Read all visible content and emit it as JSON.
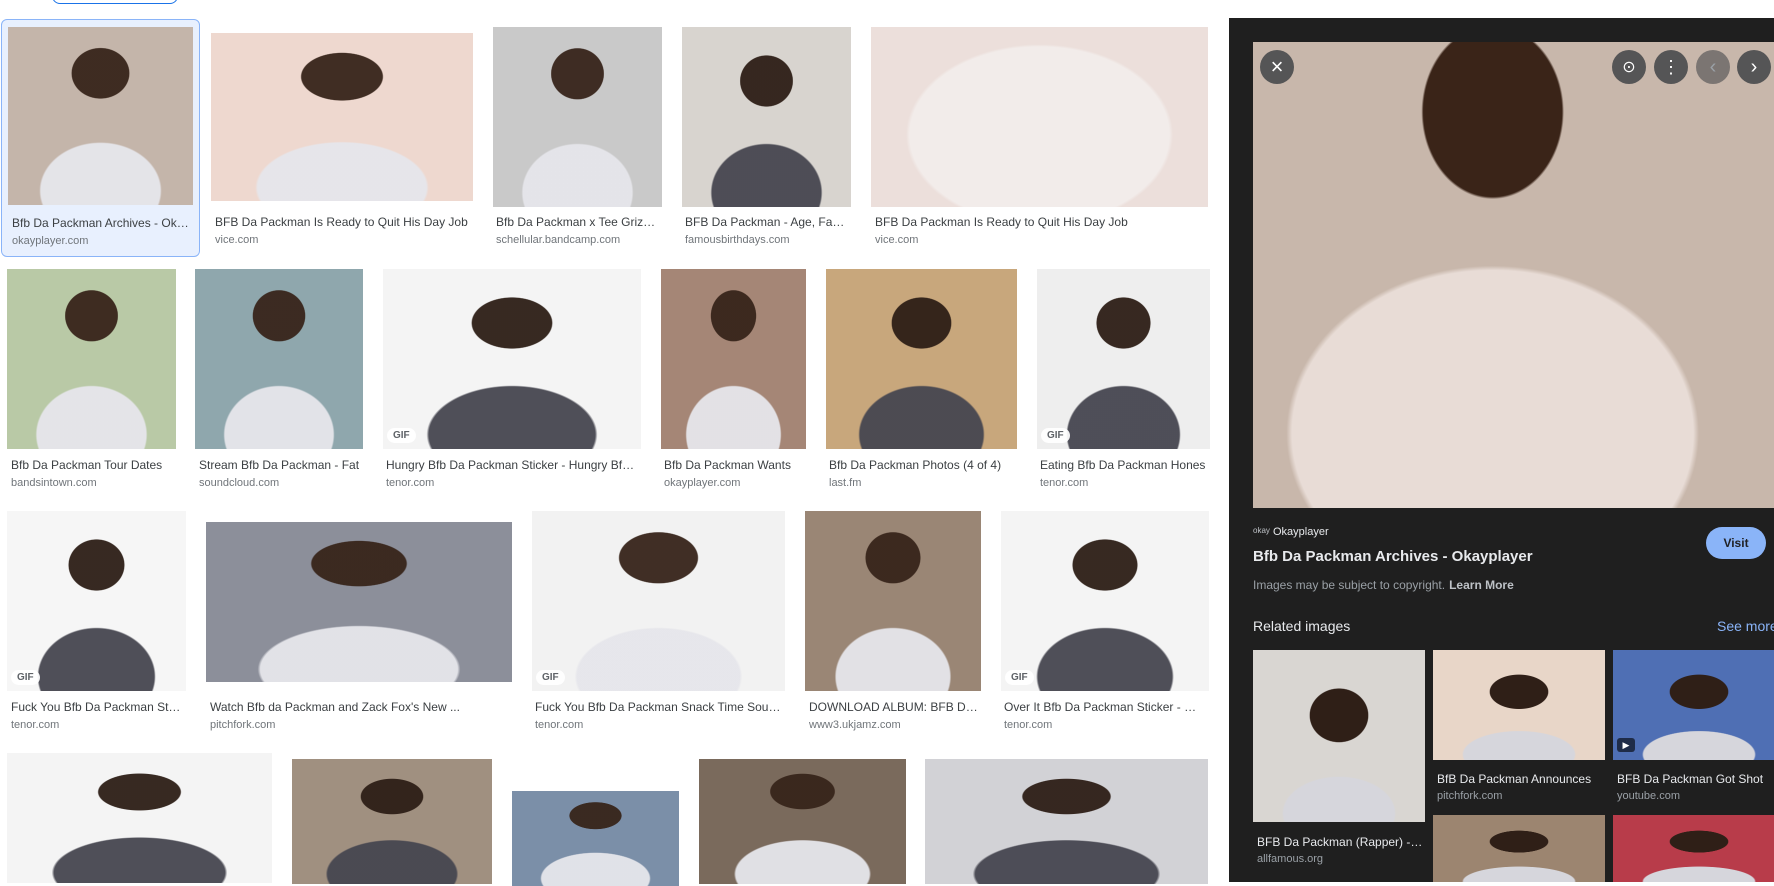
{
  "results": [
    {
      "title": "Bfb Da Packman Archives - Okayplayer",
      "source": "okayplayer.com",
      "gif": false
    },
    {
      "title": "BFB Da Packman Is Ready to Quit His Day Job",
      "source": "vice.com",
      "gif": false
    },
    {
      "title": "Bfb Da Packman x Tee Grizzley",
      "source": "schellular.bandcamp.com",
      "gif": false
    },
    {
      "title": "BFB Da Packman - Age, Family",
      "source": "famousbirthdays.com",
      "gif": false
    },
    {
      "title": "BFB Da Packman Is Ready to Quit His Day Job",
      "source": "vice.com",
      "gif": false
    },
    {
      "title": "Bfb Da Packman Tour Dates",
      "source": "bandsintown.com",
      "gif": false
    },
    {
      "title": "Stream Bfb Da Packman - Fat",
      "source": "soundcloud.com",
      "gif": false
    },
    {
      "title": "Hungry Bfb Da Packman Sticker - Hungry Bfb Da Packman",
      "source": "tenor.com",
      "gif": true
    },
    {
      "title": "Bfb Da Packman Wants",
      "source": "okayplayer.com",
      "gif": false
    },
    {
      "title": "Bfb Da Packman Photos (4 of 4)",
      "source": "last.fm",
      "gif": false
    },
    {
      "title": "Eating Bfb Da Packman Hones",
      "source": "tenor.com",
      "gif": true
    },
    {
      "title": "Fuck You Bfb Da Packman Sticker",
      "source": "tenor.com",
      "gif": true
    },
    {
      "title": "Watch Bfb da Packman and Zack Fox's New ...",
      "source": "pitchfork.com",
      "gif": false
    },
    {
      "title": "Fuck You Bfb Da Packman Snack Time Sounds",
      "source": "tenor.com",
      "gif": true
    },
    {
      "title": "DOWNLOAD ALBUM: BFB Da Packman",
      "source": "www3.ukjamz.com",
      "gif": false
    },
    {
      "title": "Over It Bfb Da Packman Sticker - Over It",
      "source": "tenor.com",
      "gif": true
    },
    {
      "title": "",
      "source": "",
      "gif": false
    },
    {
      "title": "",
      "source": "",
      "gif": false
    },
    {
      "title": "",
      "source": "",
      "gif": false
    },
    {
      "title": "",
      "source": "",
      "gif": false
    },
    {
      "title": "",
      "source": "",
      "gif": false
    }
  ],
  "gif_label": "GIF",
  "preview": {
    "source_name": "Okayplayer",
    "favicon_text": "okay",
    "title": "Bfb Da Packman Archives - Okayplayer",
    "visit_label": "Visit",
    "copyright": "Images may be subject to copyright.",
    "learn_more": "Learn More",
    "related_heading": "Related images",
    "see_more": "See more",
    "close_icon": "×",
    "lens_icon": "⊙",
    "more_icon": "⋮",
    "prev_icon": "‹",
    "next_icon": "›",
    "related": [
      {
        "title": "BFB Da Packman (Rapper) - Age",
        "source": "allfamous.org",
        "play": false
      },
      {
        "title": "BfB Da Packman Announces",
        "source": "pitchfork.com",
        "play": false
      },
      {
        "title": "BFB Da Packman Got Shot",
        "source": "youtube.com",
        "play": true
      },
      {
        "title": "",
        "source": "",
        "play": false
      },
      {
        "title": "",
        "source": "",
        "play": false
      },
      {
        "title": "",
        "source": "",
        "play": false
      }
    ]
  }
}
